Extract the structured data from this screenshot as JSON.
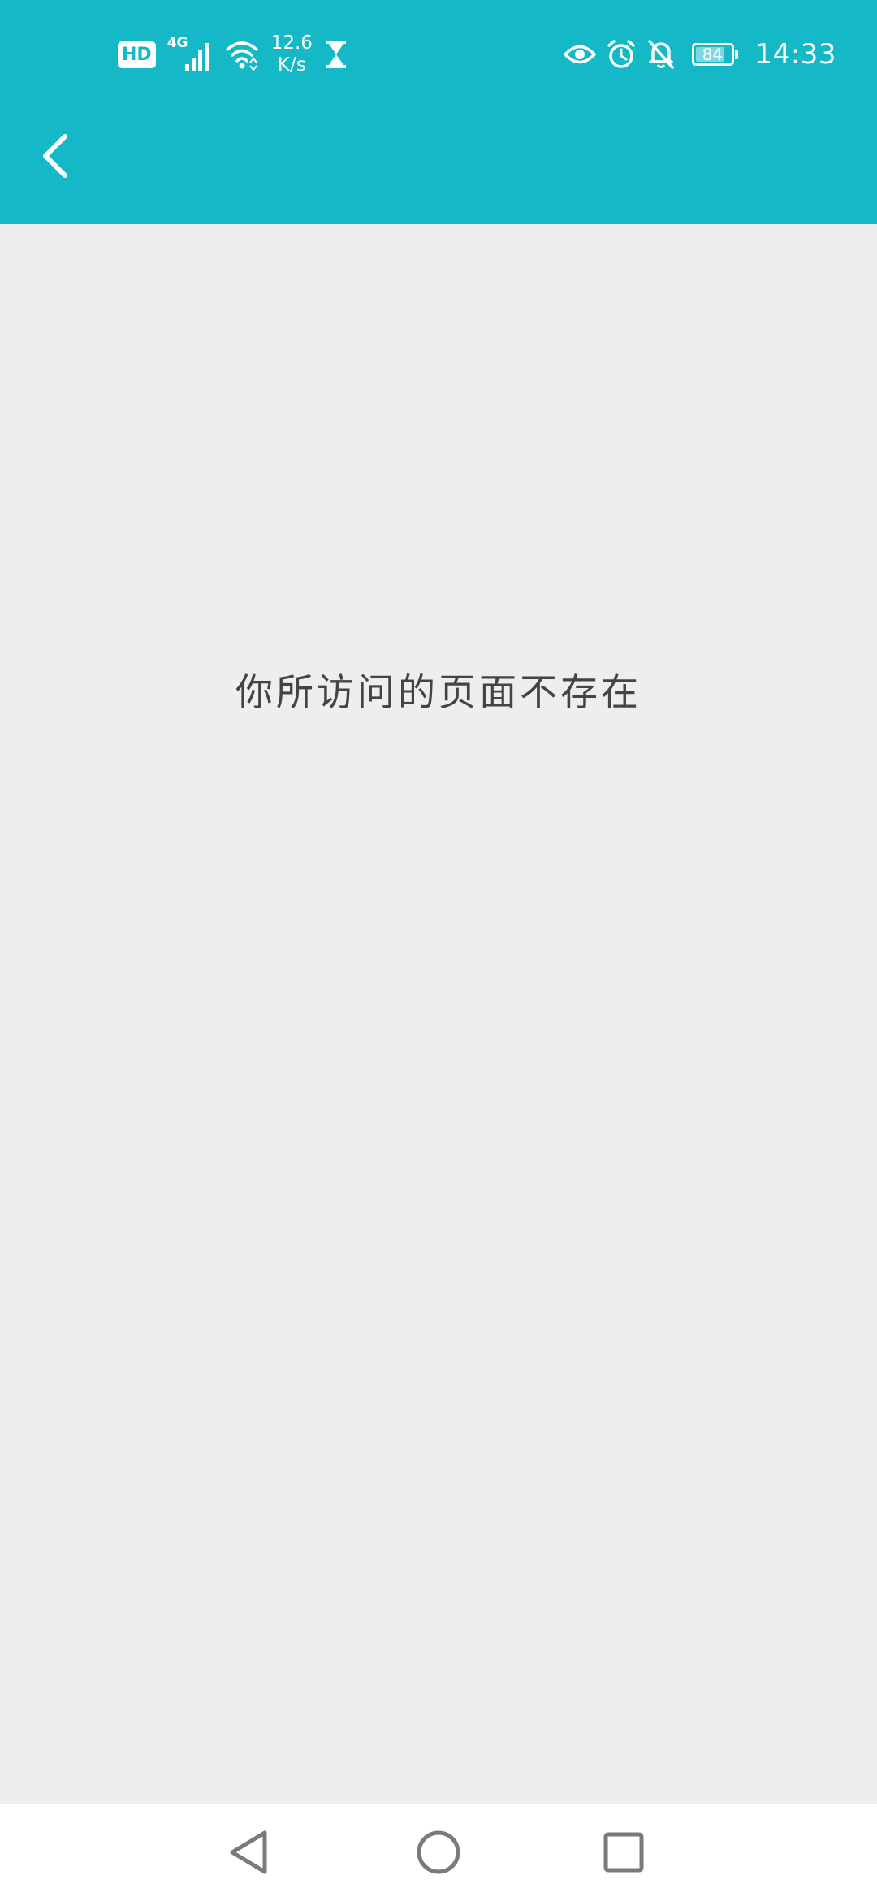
{
  "status_bar": {
    "hd_badge": "HD",
    "network_type": "4G",
    "net_speed_value": "12.6",
    "net_speed_unit": "K/s",
    "battery_level": "84",
    "battery_fraction": 0.84,
    "time": "14:33",
    "icons": [
      "hd-icon",
      "signal-icon",
      "wifi-icon",
      "hourglass-icon",
      "eye-icon",
      "alarm-icon",
      "bell-off-icon",
      "battery-icon"
    ]
  },
  "header": {
    "background_color": "#14b8c6",
    "back_icon": "chevron-left-icon"
  },
  "main": {
    "message": "你所访问的页面不存在"
  },
  "nav_bar": {
    "icons": [
      "back-triangle-icon",
      "home-circle-icon",
      "recents-square-icon"
    ]
  }
}
